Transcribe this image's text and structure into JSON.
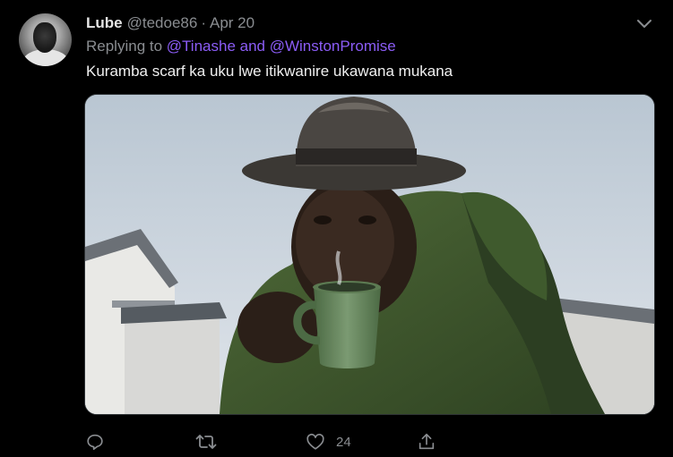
{
  "tweet": {
    "name": "Lube",
    "handle": "@tedoe86",
    "separator": "·",
    "date": "Apr 20",
    "replying_prefix": "Replying to",
    "replying_mentions": "@Tinashe and @WinstonPromise",
    "text": "Kuramba scarf ka uku lwe itikwanire ukawana mukana",
    "like_count": "24"
  },
  "icons": {
    "more": "chevron-down-icon",
    "reply": "reply-icon",
    "retweet": "retweet-icon",
    "like": "heart-icon",
    "share": "share-icon"
  },
  "colors": {
    "background": "#000000",
    "mention": "#8b5cf6",
    "muted": "#8a8d91"
  }
}
